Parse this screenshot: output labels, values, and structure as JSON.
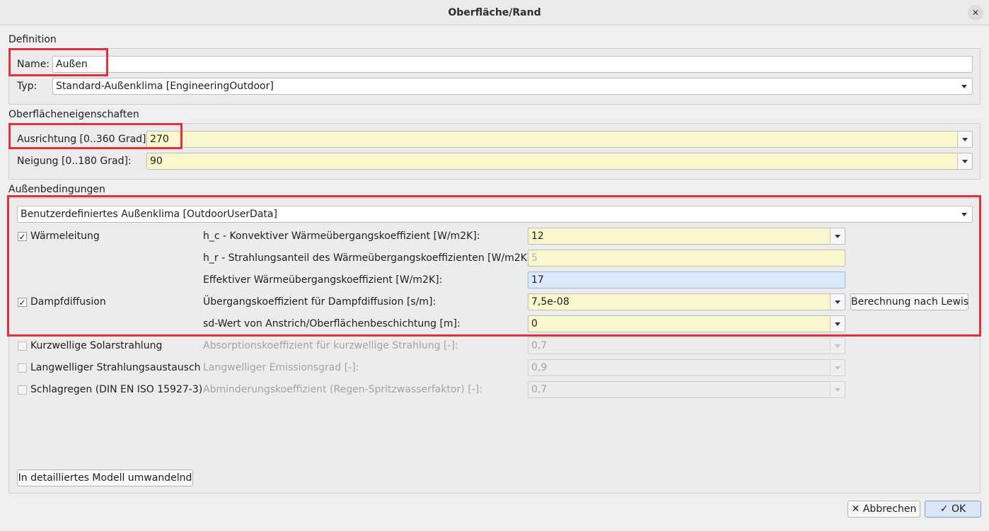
{
  "window": {
    "title": "Oberfläche/Rand",
    "close_icon": "close-icon"
  },
  "definition": {
    "section_label": "Definition",
    "name_label": "Name:",
    "name_value": "Außen",
    "type_label": "Typ:",
    "type_value": "Standard-Außenklima [EngineeringOutdoor]"
  },
  "surface": {
    "section_label": "Oberflächeneigenschaften",
    "orientation_label": "Ausrichtung [0..360 Grad]:",
    "orientation_value": "270",
    "inclination_label": "Neigung [0..180 Grad]:",
    "inclination_value": "90"
  },
  "outdoor": {
    "section_label": "Außenbedingungen",
    "climate_value": "Benutzerdefiniertes Außenklima [OutdoorUserData]",
    "heat_conduction": {
      "label": "Wärmeleitung",
      "checked": "✓",
      "hc_label": "h_c - Konvektiver Wärmeübergangskoeffizient [W/m2K]:",
      "hc_value": "12",
      "hr_label": "h_r - Strahlungsanteil des Wärmeübergangskoeffizienten [W/m2K]:",
      "hr_value": "5",
      "eff_label": "Effektiver Wärmeübergangskoeffizient [W/m2K]:",
      "eff_value": "17"
    },
    "vapor_diffusion": {
      "label": "Dampfdiffusion",
      "checked": "✓",
      "coeff_label": "Übergangskoeffizient für Dampfdiffusion [s/m]:",
      "coeff_value": "7,5e-08",
      "lewis_button": "Berechnung nach Lewis",
      "sd_label": "sd-Wert von Anstrich/Oberflächenbeschichtung [m]:",
      "sd_value": "0"
    },
    "solar": {
      "label": "Kurzwellige Solarstrahlung",
      "field_label": "Absorptionskoeffizient für kurzwellige Strahlung [-]:",
      "value": "0,7"
    },
    "longwave": {
      "label": "Langwelliger Strahlungsaustausch",
      "field_label": "Langwelliger Emissionsgrad [-]:",
      "value": "0,9"
    },
    "rain": {
      "label": "Schlagregen (DIN EN ISO 15927-3)",
      "field_label": "Abminderungskoeffizient (Regen-Spritzwasserfaktor) [-]:",
      "value": "0,7"
    },
    "convert_button": "In detailliertes Modell umwandelnd"
  },
  "footer": {
    "cancel_icon": "✕",
    "cancel_label": "Abbrechen",
    "ok_icon": "✓",
    "ok_label": "OK"
  },
  "colors": {
    "highlight": "#e0323c",
    "yellow_field": "#fbf7cd",
    "blue_field": "#dce9fa"
  }
}
